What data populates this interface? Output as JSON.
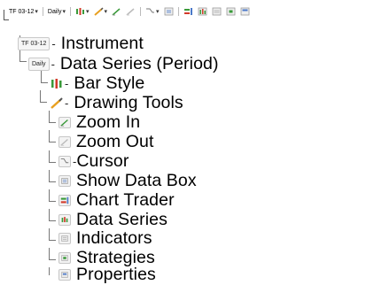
{
  "toolbar": {
    "timeframe_chip": "TF 03-12",
    "period_chip": "Daily"
  },
  "tree": {
    "items": [
      {
        "chip": "TF 03-12",
        "label": "Instrument",
        "icon": "instrument-chip-icon"
      },
      {
        "chip": "Daily",
        "label": "Data Series (Period)",
        "icon": "period-chip-icon"
      },
      {
        "label": "Bar Style",
        "icon": "bar-style-icon"
      },
      {
        "label": "Drawing Tools",
        "icon": "drawing-tools-icon"
      },
      {
        "label": "Zoom In",
        "icon": "zoom-in-icon"
      },
      {
        "label": "Zoom Out",
        "icon": "zoom-out-icon"
      },
      {
        "label": "Cursor",
        "icon": "cursor-icon"
      },
      {
        "label": "Show Data Box",
        "icon": "data-box-icon"
      },
      {
        "label": "Chart Trader",
        "icon": "chart-trader-icon"
      },
      {
        "label": "Data Series",
        "icon": "data-series-icon"
      },
      {
        "label": "Indicators",
        "icon": "indicators-icon"
      },
      {
        "label": "Strategies",
        "icon": "strategies-icon"
      },
      {
        "label": "Properties",
        "icon": "properties-icon"
      }
    ]
  },
  "colors": {
    "green": "#3a9a3a",
    "red": "#d23a2a",
    "orange": "#e8a020",
    "blue": "#4a78c8",
    "gray": "#9a9a9a"
  }
}
